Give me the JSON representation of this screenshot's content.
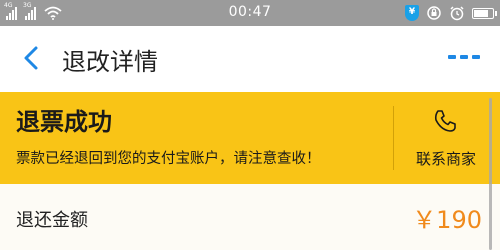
{
  "status_bar": {
    "network_a": "4G",
    "network_b": "3G",
    "time": "00:47",
    "battery_level": 0.85,
    "shield_label": "¥"
  },
  "nav": {
    "title": "退改详情"
  },
  "banner": {
    "title": "退票成功",
    "message": "票款已经退回到您的支付宝账户，请注意查收！",
    "contact_label": "联系商家",
    "background_color": "#f9c416"
  },
  "refund": {
    "label": "退还金额",
    "amount": "￥190",
    "amount_color": "#f08a1c"
  },
  "colors": {
    "accent": "#1e88e5"
  }
}
